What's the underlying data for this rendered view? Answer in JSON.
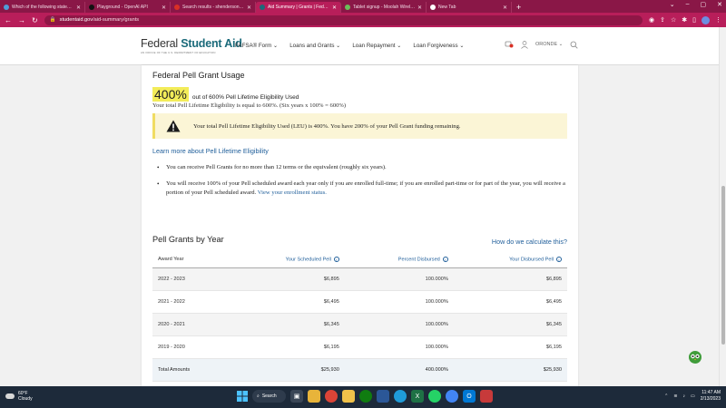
{
  "browser": {
    "tabs": [
      {
        "label": "Which of the following statemen",
        "active": false,
        "favicon_color": "#4f9dd9"
      },
      {
        "label": "Playground - OpenAI API",
        "active": false,
        "favicon_color": "#111111"
      },
      {
        "label": "Search results - shenderson71@",
        "active": false,
        "favicon_color": "#d93025"
      },
      {
        "label": "Aid Summary | Grants | Federal S",
        "active": true,
        "favicon_color": "#1a6a7a"
      },
      {
        "label": "Tablet signup - Moolah Wireless",
        "active": false,
        "favicon_color": "#6bbf59"
      },
      {
        "label": "New Tab",
        "active": false,
        "favicon_color": "#ffffff"
      }
    ],
    "url_domain": "studentaid.gov",
    "url_path": "/aid-summary/grants"
  },
  "site": {
    "logo_text_plain": "Federal ",
    "logo_text_bold": "Student Aid",
    "logo_sub": "AN OFFICE OF THE U.S. DEPARTMENT OF EDUCATION",
    "nav": [
      {
        "label": "FAFSA® Form"
      },
      {
        "label": "Loans and Grants"
      },
      {
        "label": "Loan Repayment"
      },
      {
        "label": "Loan Forgiveness"
      }
    ],
    "user_name": "ORONDE"
  },
  "usage": {
    "title": "Federal Pell Grant Usage",
    "percent": "400%",
    "percent_text": "out of 600% Pell Lifetime Eligibility Used",
    "note": "Your total Pell Lifetime Eligibility is equal to 600%. (Six years x 100% = 600%)",
    "alert": "Your total Pell Lifetime Eligibility Used (LEU) is 400%. You have 200% of your Pell Grant funding remaining.",
    "learn_link": "Learn more about Pell Lifetime Eligibility",
    "bullet1": "You can receive Pell Grants for no more than 12 terms or the equivalent (roughly six years).",
    "bullet2": "You will receive 100% of your Pell scheduled award each year only if you are enrolled full-time; if you are enrolled part-time or for part of the year, you will receive a portion of your Pell scheduled award.",
    "bullet2_link": "View your enrollment status."
  },
  "grants": {
    "title": "Pell Grants by Year",
    "calc_link": "How do we calculate this?",
    "headers": {
      "year": "Award Year",
      "scheduled": "Your Scheduled Pell",
      "percent": "Percent Disbursed",
      "disbursed": "Your Disbursed Pell"
    },
    "rows": [
      {
        "year": "2022 - 2023",
        "scheduled": "$6,895",
        "percent": "100.000%",
        "disbursed": "$6,895"
      },
      {
        "year": "2021 - 2022",
        "scheduled": "$6,495",
        "percent": "100.000%",
        "disbursed": "$6,495"
      },
      {
        "year": "2020 - 2021",
        "scheduled": "$6,345",
        "percent": "100.000%",
        "disbursed": "$6,345"
      },
      {
        "year": "2019 - 2020",
        "scheduled": "$6,195",
        "percent": "100.000%",
        "disbursed": "$6,195"
      }
    ],
    "total": {
      "label": "Total Amounts",
      "scheduled": "$25,930",
      "percent": "400.000%",
      "disbursed": "$25,930"
    }
  },
  "taskbar": {
    "temp": "60°F",
    "condition": "Cloudy",
    "search_label": "Search",
    "time": "11:47 AM",
    "date": "2/13/2023"
  },
  "colors": {
    "browser_frame": "#8a1747",
    "browser_active": "#b81e5a",
    "link_blue": "#1f5e9a",
    "highlight_yellow": "#f3ec59",
    "alert_bg": "#fbf5d6"
  }
}
